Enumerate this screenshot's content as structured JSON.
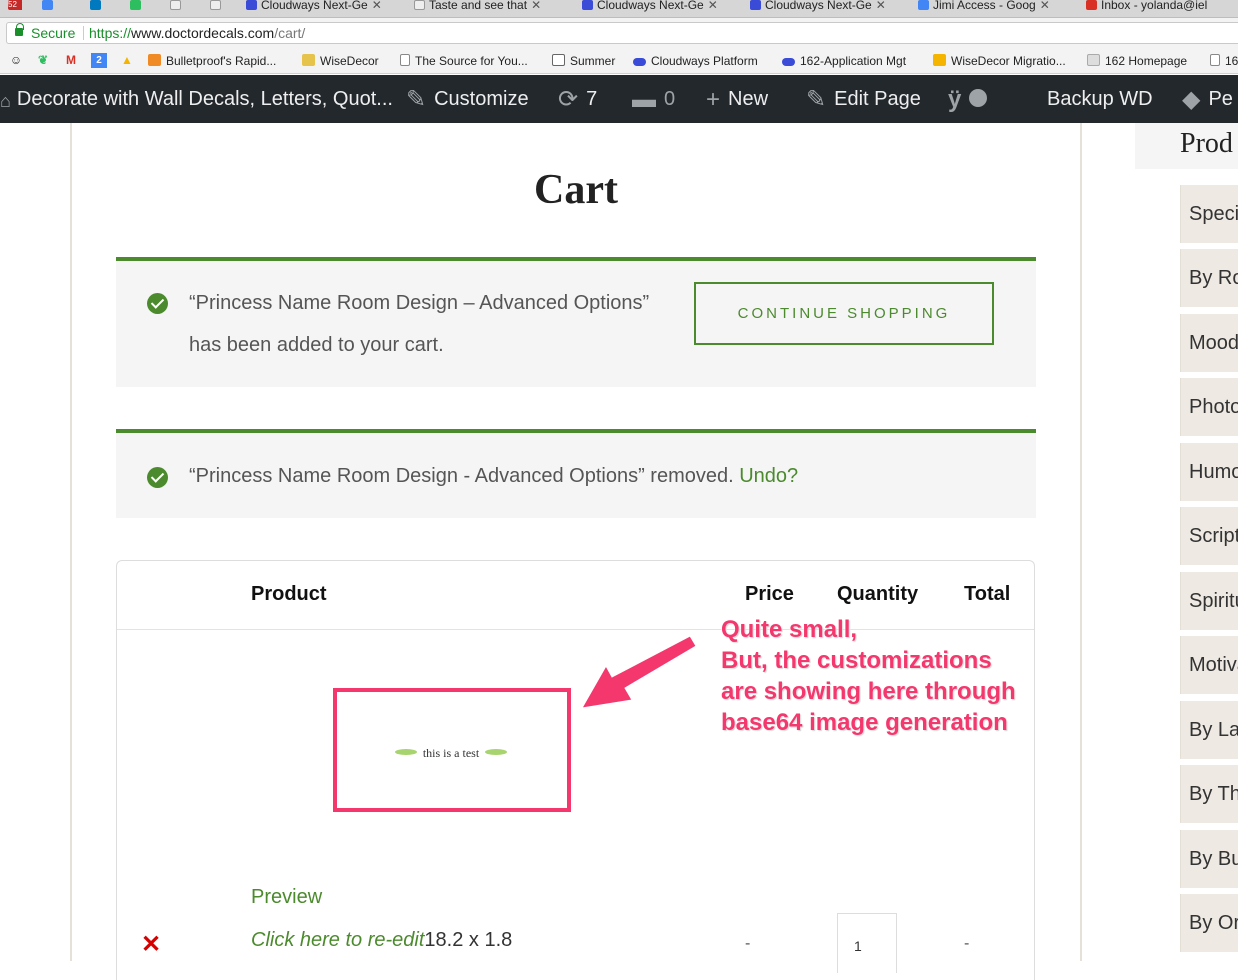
{
  "browser": {
    "tabs": [
      {
        "label": "52",
        "color": "#c62828"
      },
      {
        "label": "",
        "color": "#4285f4"
      },
      {
        "label": "",
        "color": "#0079bf"
      },
      {
        "label": "",
        "color": "#2dbe60"
      },
      {
        "label": "",
        "color": "#bbbbbb"
      },
      {
        "label": "",
        "color": "#bbbbbb"
      },
      {
        "label": "Cloudways Next-Ge",
        "color": "#3a4bd8"
      },
      {
        "label": "Taste and see that",
        "color": "#bbbbbb"
      },
      {
        "label": "Cloudways Next-Ge",
        "color": "#3a4bd8"
      },
      {
        "label": "Cloudways Next-Ge",
        "color": "#3a4bd8"
      },
      {
        "label": "Jimi Access - Goog",
        "color": "#4285f4"
      },
      {
        "label": "Inbox - yolanda@iel",
        "color": "#d93025"
      }
    ],
    "tab_close": "✕",
    "address": {
      "secure_label": "Secure",
      "scheme": "https://",
      "host": "www.doctordecals.com",
      "path": "/cart/"
    },
    "bookmarks": [
      {
        "label": "Bulletproof's Rapid...",
        "icon": "bulletproof-icon"
      },
      {
        "label": "WiseDecor",
        "icon": "wisedecor-icon"
      },
      {
        "label": "The Source for You...",
        "icon": "page-icon"
      },
      {
        "label": "Summer",
        "icon": "folder-icon"
      },
      {
        "label": "Cloudways Platform",
        "icon": "cloud-icon"
      },
      {
        "label": "162-Application Mgt",
        "icon": "cloud-icon"
      },
      {
        "label": "WiseDecor Migratio...",
        "icon": "drive-icon"
      },
      {
        "label": "162 Homepage",
        "icon": "image-icon"
      },
      {
        "label": "16",
        "icon": "page-icon"
      }
    ],
    "bookmark_icons": {
      "gmail": "M",
      "calendar": "2"
    }
  },
  "adminbar": {
    "site_name": "Decorate with Wall Decals, Letters, Quot...",
    "customize": "Customize",
    "updates_count": "7",
    "comments_count": "0",
    "new_label": "New",
    "edit_page": "Edit Page",
    "backup": "Backup WD",
    "last": "Pe"
  },
  "page": {
    "title": "Cart",
    "notice_added": {
      "line1": "“Princess Name Room Design – Advanced Options”",
      "line2": "has been added to your cart.",
      "button": "CONTINUE SHOPPING"
    },
    "notice_removed": {
      "text": "“Princess Name Room Design - Advanced Options” removed.",
      "undo": "Undo?"
    },
    "table": {
      "headers": {
        "product": "Product",
        "price": "Price",
        "quantity": "Quantity",
        "total": "Total"
      },
      "row": {
        "preview_text": "this is a test",
        "preview_label": "Preview",
        "reedit_link": "Click here to re-edit",
        "dimensions": "18.2 x 1.8",
        "price": "-",
        "quantity": "1",
        "total": "-",
        "remove": "✕"
      }
    },
    "annotation": {
      "line1": "Quite small,",
      "line2": "But, the customizations",
      "line3": "are showing here through",
      "line4": "base64 image generation"
    }
  },
  "sidebar": {
    "heading": "Prod",
    "items": [
      "Speci",
      "By Ro",
      "Mood",
      "Photo",
      "Humo",
      "Script",
      "Spiritu",
      "Motiva",
      "By La",
      "By Th",
      "By Bu",
      "By Or"
    ]
  },
  "colors": {
    "accent_green": "#4c8a2e",
    "annotation_pink": "#f4376d",
    "adminbar_bg": "#23282d",
    "remove_red": "#d50000"
  }
}
